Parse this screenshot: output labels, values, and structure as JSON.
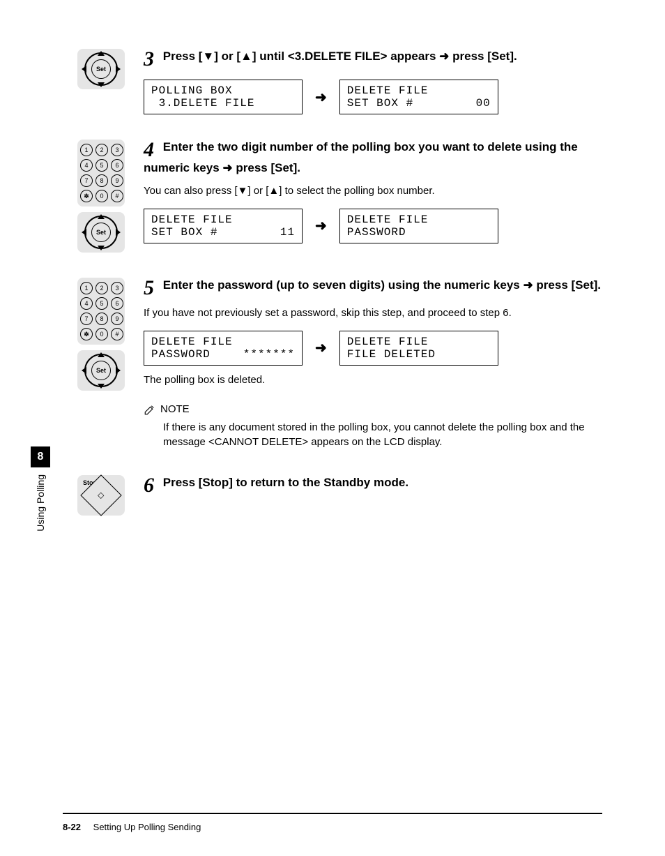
{
  "sidetab": {
    "chapter": "8",
    "label": "Using Polling"
  },
  "step3": {
    "num": "3",
    "head_a": "Press [▼] or [▲] until <3.DELETE FILE> appears ",
    "head_b": " press [Set].",
    "lcd1_l1": "POLLING BOX",
    "lcd1_l2": " 3.DELETE FILE",
    "lcd2_l1": "DELETE FILE",
    "lcd2_l2a": "SET BOX #",
    "lcd2_l2b": "00"
  },
  "step4": {
    "num": "4",
    "head_a": "Enter the two digit number of the polling box you want to delete using the numeric keys ",
    "head_b": " press [Set].",
    "sub": "You can also press [▼] or [▲] to select the polling box number.",
    "lcd1_l1": "DELETE FILE",
    "lcd1_l2a": "SET BOX #",
    "lcd1_l2b": "11",
    "lcd2_l1": "DELETE FILE",
    "lcd2_l2": "PASSWORD"
  },
  "step5": {
    "num": "5",
    "head_a": "Enter the password (up to seven digits) using the numeric keys ",
    "head_b": " press [Set].",
    "sub": "If you have not previously set a password, skip this step, and proceed to step 6.",
    "lcd1_l1": "DELETE FILE",
    "lcd1_l2a": "PASSWORD",
    "lcd1_l2b": "*******",
    "lcd2_l1": "DELETE FILE",
    "lcd2_l2": "FILE DELETED",
    "after": "The polling box is deleted."
  },
  "note": {
    "label": "NOTE",
    "body": "If there is any document stored in the polling box, you cannot delete the polling box and the message <CANNOT DELETE> appears on the LCD display."
  },
  "step6": {
    "num": "6",
    "head": "Press [Stop] to return to the Standby mode."
  },
  "keypad": [
    "1",
    "2",
    "3",
    "4",
    "5",
    "6",
    "7",
    "8",
    "9",
    "✽",
    "0",
    "#"
  ],
  "navpad_set": "Set",
  "stop_label": "Stop",
  "arrow_right": "➜",
  "arrow_inline": "➜",
  "footer": {
    "page": "8-22",
    "title": "Setting Up Polling Sending"
  }
}
